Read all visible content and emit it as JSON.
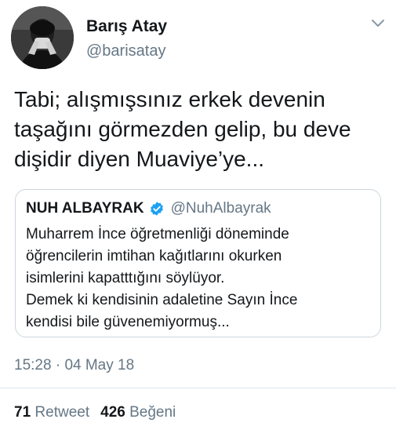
{
  "author": {
    "name": "Barış Atay",
    "handle": "@barisatay"
  },
  "tweet": {
    "lines": [
      "Tabi; alışmışsınız erkek devenin",
      "taşağını görmezden gelip, bu deve",
      "dişidir diyen Muaviye’ye..."
    ]
  },
  "quoted": {
    "name": "NUH ALBAYRAK",
    "handle": "@NuhAlbayrak",
    "lines": [
      "Muharrem İnce öğretmenliği döneminde",
      "öğrencilerin imtihan kağıtlarını okurken",
      "isimlerini kapatttığını söylüyor.",
      "Demek ki kendisinin adaletine Sayın İnce",
      "kendisi bile güvenemiyormuş..."
    ]
  },
  "meta": {
    "time": "15:28",
    "separator": " · ",
    "date": "04 May 18"
  },
  "stats": {
    "retweet_count": "71",
    "retweet_label": "Retweet",
    "like_count": "426",
    "like_label": "Beğeni"
  },
  "icons": {
    "menu": "chevron-down-icon",
    "verified": "verified-badge-icon"
  },
  "colors": {
    "text": "#14171a",
    "secondary": "#657786",
    "verified": "#1da1f2",
    "border": "#ccd6dd"
  }
}
